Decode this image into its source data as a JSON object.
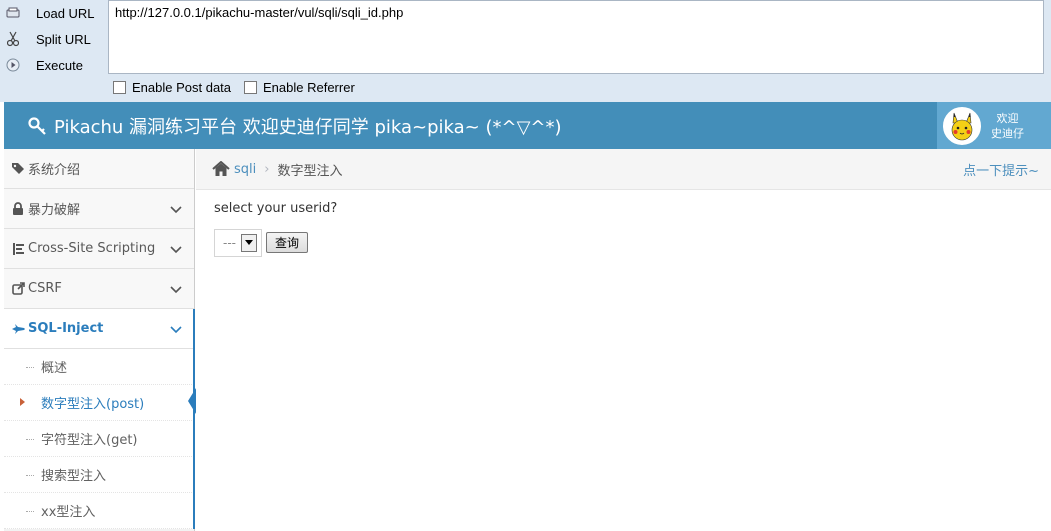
{
  "hackbar": {
    "load_url": "Load URL",
    "split_url": "Split URL",
    "execute": "Execute",
    "url_value": "http://127.0.0.1/pikachu-master/vul/sqli/sqli_id.php",
    "enable_post": "Enable Post data",
    "enable_referrer": "Enable Referrer"
  },
  "header": {
    "title": "Pikachu 漏洞练习平台 欢迎史迪仔同学 pika~pika~ (*^▽^*)",
    "welcome_line1": "欢迎",
    "welcome_line2": "史迪仔"
  },
  "sidebar": {
    "items": [
      {
        "label": "系统介绍",
        "icon": "tags-icon"
      },
      {
        "label": "暴力破解",
        "icon": "lock-icon"
      },
      {
        "label": "Cross-Site Scripting",
        "icon": "list-icon"
      },
      {
        "label": "CSRF",
        "icon": "share-icon"
      },
      {
        "label": "SQL-Inject",
        "icon": "fighter-jet-icon"
      }
    ],
    "sub_items": [
      {
        "label": "概述"
      },
      {
        "label": "数字型注入(post)"
      },
      {
        "label": "字符型注入(get)"
      },
      {
        "label": "搜索型注入"
      },
      {
        "label": "xx型注入"
      }
    ]
  },
  "breadcrumb": {
    "parent": "sqli",
    "current": "数字型注入"
  },
  "hint": "点一下提示~",
  "main": {
    "question": "select your userid?",
    "select_value": "---",
    "query_button": "查询"
  },
  "colors": {
    "header": "#438eb9",
    "accent": "#2b7dbc",
    "hackbar": "#dde8f3"
  }
}
